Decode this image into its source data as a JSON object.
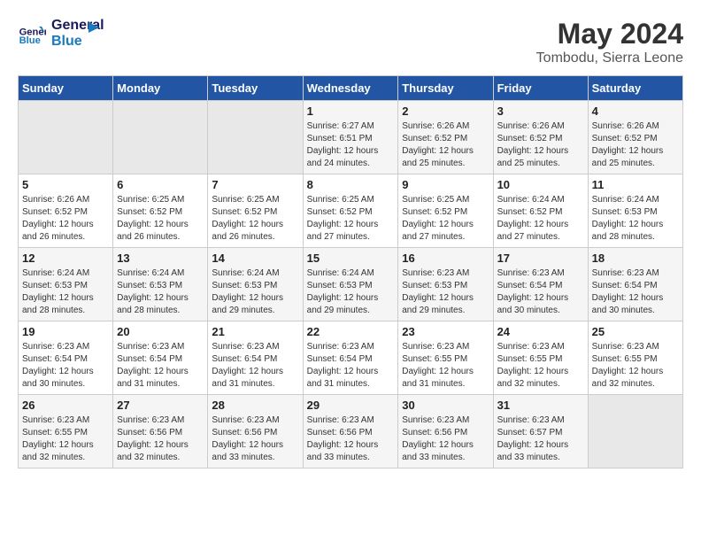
{
  "header": {
    "logo_line1": "General",
    "logo_line2": "Blue",
    "month_year": "May 2024",
    "location": "Tombodu, Sierra Leone"
  },
  "weekdays": [
    "Sunday",
    "Monday",
    "Tuesday",
    "Wednesday",
    "Thursday",
    "Friday",
    "Saturday"
  ],
  "weeks": [
    [
      {
        "day": "",
        "sunrise": "",
        "sunset": "",
        "daylight": "",
        "empty": true
      },
      {
        "day": "",
        "sunrise": "",
        "sunset": "",
        "daylight": "",
        "empty": true
      },
      {
        "day": "",
        "sunrise": "",
        "sunset": "",
        "daylight": "",
        "empty": true
      },
      {
        "day": "1",
        "sunrise": "Sunrise: 6:27 AM",
        "sunset": "Sunset: 6:51 PM",
        "daylight": "Daylight: 12 hours and 24 minutes."
      },
      {
        "day": "2",
        "sunrise": "Sunrise: 6:26 AM",
        "sunset": "Sunset: 6:52 PM",
        "daylight": "Daylight: 12 hours and 25 minutes."
      },
      {
        "day": "3",
        "sunrise": "Sunrise: 6:26 AM",
        "sunset": "Sunset: 6:52 PM",
        "daylight": "Daylight: 12 hours and 25 minutes."
      },
      {
        "day": "4",
        "sunrise": "Sunrise: 6:26 AM",
        "sunset": "Sunset: 6:52 PM",
        "daylight": "Daylight: 12 hours and 25 minutes."
      }
    ],
    [
      {
        "day": "5",
        "sunrise": "Sunrise: 6:26 AM",
        "sunset": "Sunset: 6:52 PM",
        "daylight": "Daylight: 12 hours and 26 minutes."
      },
      {
        "day": "6",
        "sunrise": "Sunrise: 6:25 AM",
        "sunset": "Sunset: 6:52 PM",
        "daylight": "Daylight: 12 hours and 26 minutes."
      },
      {
        "day": "7",
        "sunrise": "Sunrise: 6:25 AM",
        "sunset": "Sunset: 6:52 PM",
        "daylight": "Daylight: 12 hours and 26 minutes."
      },
      {
        "day": "8",
        "sunrise": "Sunrise: 6:25 AM",
        "sunset": "Sunset: 6:52 PM",
        "daylight": "Daylight: 12 hours and 27 minutes."
      },
      {
        "day": "9",
        "sunrise": "Sunrise: 6:25 AM",
        "sunset": "Sunset: 6:52 PM",
        "daylight": "Daylight: 12 hours and 27 minutes."
      },
      {
        "day": "10",
        "sunrise": "Sunrise: 6:24 AM",
        "sunset": "Sunset: 6:52 PM",
        "daylight": "Daylight: 12 hours and 27 minutes."
      },
      {
        "day": "11",
        "sunrise": "Sunrise: 6:24 AM",
        "sunset": "Sunset: 6:53 PM",
        "daylight": "Daylight: 12 hours and 28 minutes."
      }
    ],
    [
      {
        "day": "12",
        "sunrise": "Sunrise: 6:24 AM",
        "sunset": "Sunset: 6:53 PM",
        "daylight": "Daylight: 12 hours and 28 minutes."
      },
      {
        "day": "13",
        "sunrise": "Sunrise: 6:24 AM",
        "sunset": "Sunset: 6:53 PM",
        "daylight": "Daylight: 12 hours and 28 minutes."
      },
      {
        "day": "14",
        "sunrise": "Sunrise: 6:24 AM",
        "sunset": "Sunset: 6:53 PM",
        "daylight": "Daylight: 12 hours and 29 minutes."
      },
      {
        "day": "15",
        "sunrise": "Sunrise: 6:24 AM",
        "sunset": "Sunset: 6:53 PM",
        "daylight": "Daylight: 12 hours and 29 minutes."
      },
      {
        "day": "16",
        "sunrise": "Sunrise: 6:23 AM",
        "sunset": "Sunset: 6:53 PM",
        "daylight": "Daylight: 12 hours and 29 minutes."
      },
      {
        "day": "17",
        "sunrise": "Sunrise: 6:23 AM",
        "sunset": "Sunset: 6:54 PM",
        "daylight": "Daylight: 12 hours and 30 minutes."
      },
      {
        "day": "18",
        "sunrise": "Sunrise: 6:23 AM",
        "sunset": "Sunset: 6:54 PM",
        "daylight": "Daylight: 12 hours and 30 minutes."
      }
    ],
    [
      {
        "day": "19",
        "sunrise": "Sunrise: 6:23 AM",
        "sunset": "Sunset: 6:54 PM",
        "daylight": "Daylight: 12 hours and 30 minutes."
      },
      {
        "day": "20",
        "sunrise": "Sunrise: 6:23 AM",
        "sunset": "Sunset: 6:54 PM",
        "daylight": "Daylight: 12 hours and 31 minutes."
      },
      {
        "day": "21",
        "sunrise": "Sunrise: 6:23 AM",
        "sunset": "Sunset: 6:54 PM",
        "daylight": "Daylight: 12 hours and 31 minutes."
      },
      {
        "day": "22",
        "sunrise": "Sunrise: 6:23 AM",
        "sunset": "Sunset: 6:54 PM",
        "daylight": "Daylight: 12 hours and 31 minutes."
      },
      {
        "day": "23",
        "sunrise": "Sunrise: 6:23 AM",
        "sunset": "Sunset: 6:55 PM",
        "daylight": "Daylight: 12 hours and 31 minutes."
      },
      {
        "day": "24",
        "sunrise": "Sunrise: 6:23 AM",
        "sunset": "Sunset: 6:55 PM",
        "daylight": "Daylight: 12 hours and 32 minutes."
      },
      {
        "day": "25",
        "sunrise": "Sunrise: 6:23 AM",
        "sunset": "Sunset: 6:55 PM",
        "daylight": "Daylight: 12 hours and 32 minutes."
      }
    ],
    [
      {
        "day": "26",
        "sunrise": "Sunrise: 6:23 AM",
        "sunset": "Sunset: 6:55 PM",
        "daylight": "Daylight: 12 hours and 32 minutes."
      },
      {
        "day": "27",
        "sunrise": "Sunrise: 6:23 AM",
        "sunset": "Sunset: 6:56 PM",
        "daylight": "Daylight: 12 hours and 32 minutes."
      },
      {
        "day": "28",
        "sunrise": "Sunrise: 6:23 AM",
        "sunset": "Sunset: 6:56 PM",
        "daylight": "Daylight: 12 hours and 33 minutes."
      },
      {
        "day": "29",
        "sunrise": "Sunrise: 6:23 AM",
        "sunset": "Sunset: 6:56 PM",
        "daylight": "Daylight: 12 hours and 33 minutes."
      },
      {
        "day": "30",
        "sunrise": "Sunrise: 6:23 AM",
        "sunset": "Sunset: 6:56 PM",
        "daylight": "Daylight: 12 hours and 33 minutes."
      },
      {
        "day": "31",
        "sunrise": "Sunrise: 6:23 AM",
        "sunset": "Sunset: 6:57 PM",
        "daylight": "Daylight: 12 hours and 33 minutes."
      },
      {
        "day": "",
        "sunrise": "",
        "sunset": "",
        "daylight": "",
        "empty": true
      }
    ]
  ]
}
